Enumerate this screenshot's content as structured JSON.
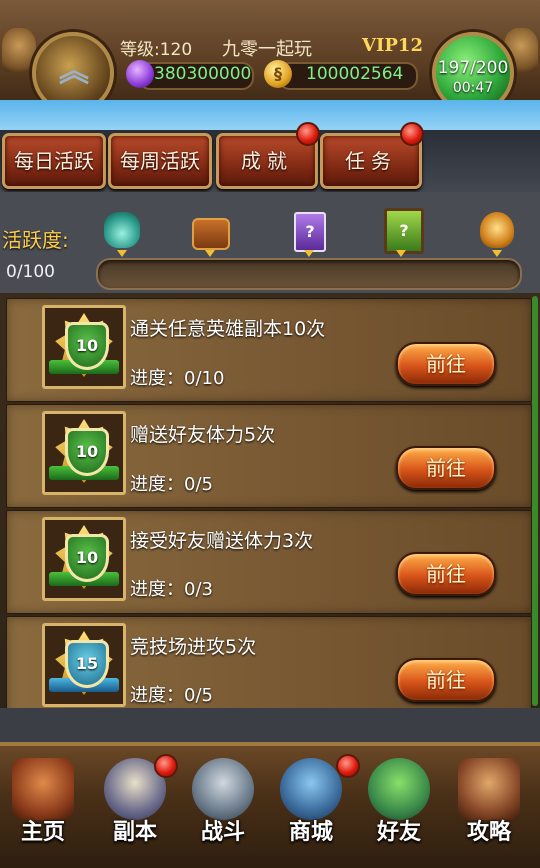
{
  "header": {
    "level_label": "等级:120",
    "server_name": "九零一起玩",
    "vip_label": "VIP12",
    "gems": "380300000",
    "gold": "100002564",
    "gold_icon_glyph": "§",
    "energy": "197/200",
    "energy_timer": "00:47",
    "rank_icon": "chevron-rank-icon"
  },
  "tabs": [
    {
      "label": "每日活跃",
      "badge": false
    },
    {
      "label": "每周活跃",
      "badge": false
    },
    {
      "label": "成就",
      "badge": true
    },
    {
      "label": "任务",
      "badge": true
    }
  ],
  "activity": {
    "label": "活跃度:",
    "count": "0/100",
    "progress_fraction": 0,
    "rewards": [
      "potion-icon",
      "chest-icon",
      "purple-mystery-card-icon",
      "green-mystery-card-icon",
      "medal-icon"
    ],
    "card_glyph": "?"
  },
  "quests": [
    {
      "title": "通关任意英雄副本10次",
      "progress": "进度：0/10",
      "points": "10",
      "badge_color": "green",
      "button": "前往"
    },
    {
      "title": "赠送好友体力5次",
      "progress": "进度：0/5",
      "points": "10",
      "badge_color": "green",
      "button": "前往"
    },
    {
      "title": "接受好友赠送体力3次",
      "progress": "进度：0/3",
      "points": "10",
      "badge_color": "green",
      "button": "前往"
    },
    {
      "title": "竞技场进攻5次",
      "progress": "进度：0/5",
      "points": "15",
      "badge_color": "blue",
      "button": "前往"
    }
  ],
  "bottom_nav": [
    {
      "label": "主页",
      "icon": "house-icon",
      "badge": false
    },
    {
      "label": "副本",
      "icon": "skull-icon",
      "badge": true
    },
    {
      "label": "战斗",
      "icon": "crossed-swords-icon",
      "badge": false
    },
    {
      "label": "商城",
      "icon": "shop-monster-icon",
      "badge": true
    },
    {
      "label": "好友",
      "icon": "friends-icon",
      "badge": false
    },
    {
      "label": "攻略",
      "icon": "guide-book-icon",
      "badge": false
    }
  ],
  "colors": {
    "accent_gold": "#ffcf4a",
    "currency_green": "#7ef08a",
    "button_orange": "#d8541a",
    "badge_red": "#e01c10"
  }
}
